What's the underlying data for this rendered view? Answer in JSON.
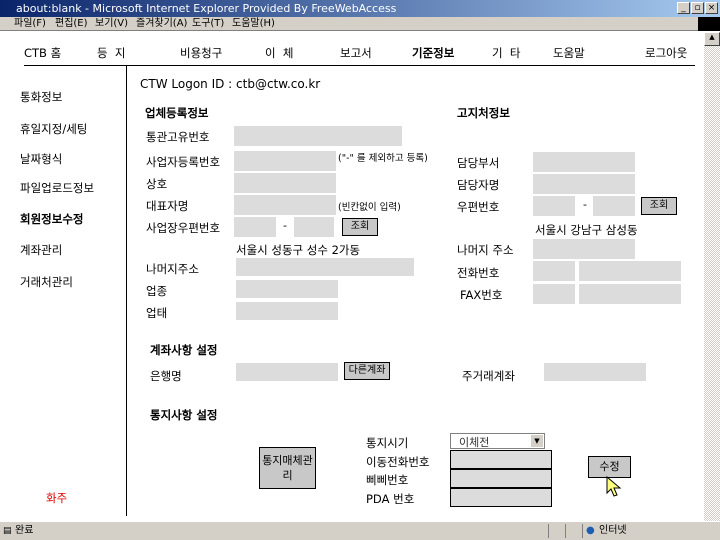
{
  "window": {
    "title": "about:blank - Microsoft Internet Explorer Provided By FreeWebAccess",
    "menu": [
      "파일(F)",
      "편집(E)",
      "보기(V)",
      "즐겨찾기(A)",
      "도구(T)",
      "도움말(H)"
    ]
  },
  "nav": [
    "CTB 홈",
    "등  지",
    "비용청구",
    "이  체",
    "보고서",
    "기준정보",
    "기  타",
    "도움말",
    "로그아웃"
  ],
  "sidebar": [
    "통화정보",
    "휴일지정/세팅",
    "날짜형식",
    "파일업로드정보",
    "회원정보수정",
    "계좌관리",
    "거래처관리"
  ],
  "sidebar_footer": "화주",
  "logon": "CTW Logon ID : ctb@ctw.co.kr",
  "company": {
    "heading": "업체등록정보",
    "labels": [
      "통관고유번호",
      "사업자등록번호",
      "상호",
      "대표자명",
      "사업장우편번호",
      "나머지주소",
      "업종",
      "업태"
    ],
    "note_bizno": "(\"-\" 를 제외하고 등록)",
    "note_name": "(빈칸없이 입력)",
    "address": "서울시 성동구 성수 2가동",
    "search": "조회",
    "dash": "-"
  },
  "billing": {
    "heading": "고지처정보",
    "labels": [
      "담당부서",
      "담당자명",
      "우편번호",
      "나머지 주소",
      "전화번호",
      "FAX번호"
    ],
    "address": "서울시 강남구 삼성동",
    "search": "조회",
    "dash": "-"
  },
  "account": {
    "heading": "계좌사항 설정",
    "bank_label": "은행명",
    "other_button": "다른계좌",
    "main_label": "주거래계좌"
  },
  "notify": {
    "heading": "통지사항 설정",
    "media_button": "통지매체관리",
    "labels": [
      "통지시기",
      "이동전화번호",
      "삐삐번호",
      "PDA 번호"
    ],
    "timing_value": "이체전",
    "submit": "수정"
  },
  "status": {
    "left": "완료",
    "zone": "인터넷"
  }
}
